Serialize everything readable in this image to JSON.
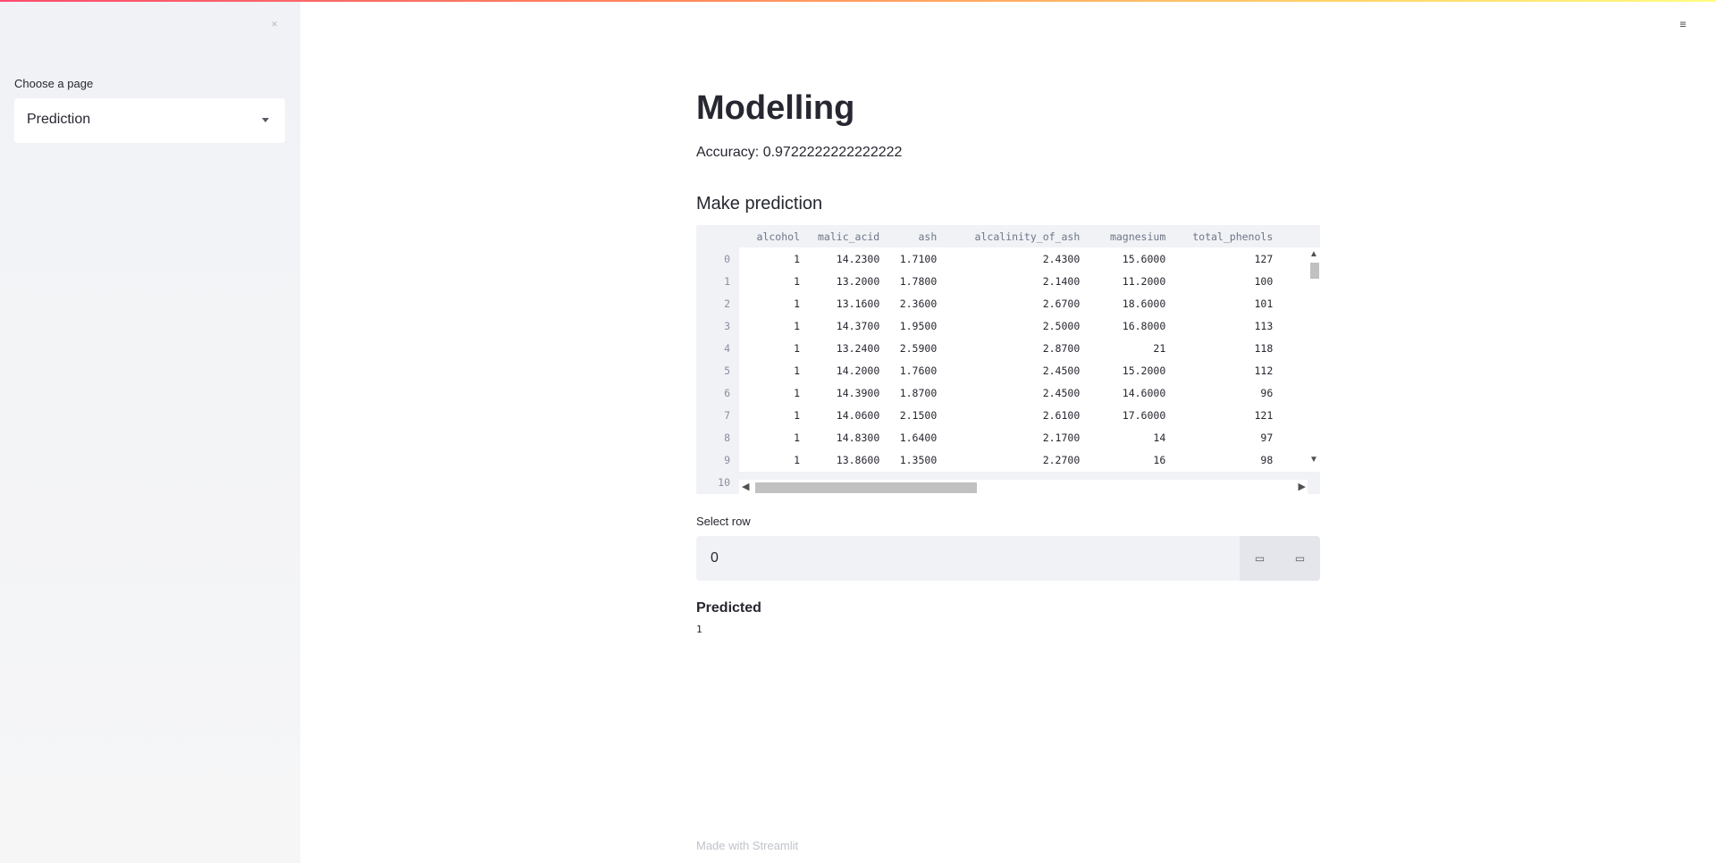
{
  "sidebar": {
    "collapse_icon": "collapse-icon",
    "select": {
      "label": "Choose a page",
      "value": "Prediction"
    }
  },
  "header": {
    "menu_icon": "hamburger-menu-icon"
  },
  "main": {
    "title": "Modelling",
    "accuracy": "Accuracy: 0.9722222222222222",
    "subheader": "Make prediction",
    "dataframe": {
      "columns": [
        "alcohol",
        "malic_acid",
        "ash",
        "alcalinity_of_ash",
        "magnesium",
        "total_phenols"
      ],
      "rows": [
        {
          "index": "0",
          "cells": [
            "1",
            "14.2300",
            "1.7100",
            "2.4300",
            "15.6000",
            "127"
          ]
        },
        {
          "index": "1",
          "cells": [
            "1",
            "13.2000",
            "1.7800",
            "2.1400",
            "11.2000",
            "100"
          ]
        },
        {
          "index": "2",
          "cells": [
            "1",
            "13.1600",
            "2.3600",
            "2.6700",
            "18.6000",
            "101"
          ]
        },
        {
          "index": "3",
          "cells": [
            "1",
            "14.3700",
            "1.9500",
            "2.5000",
            "16.8000",
            "113"
          ]
        },
        {
          "index": "4",
          "cells": [
            "1",
            "13.2400",
            "2.5900",
            "2.8700",
            "21",
            "118"
          ]
        },
        {
          "index": "5",
          "cells": [
            "1",
            "14.2000",
            "1.7600",
            "2.4500",
            "15.2000",
            "112"
          ]
        },
        {
          "index": "6",
          "cells": [
            "1",
            "14.3900",
            "1.8700",
            "2.4500",
            "14.6000",
            "96"
          ]
        },
        {
          "index": "7",
          "cells": [
            "1",
            "14.0600",
            "2.1500",
            "2.6100",
            "17.6000",
            "121"
          ]
        },
        {
          "index": "8",
          "cells": [
            "1",
            "14.8300",
            "1.6400",
            "2.1700",
            "14",
            "97"
          ]
        },
        {
          "index": "9",
          "cells": [
            "1",
            "13.8600",
            "1.3500",
            "2.2700",
            "16",
            "98"
          ]
        },
        {
          "index": "10",
          "cells": [
            "",
            "",
            "",
            "",
            "",
            ""
          ]
        }
      ]
    },
    "number_input": {
      "label": "Select row",
      "value": "0",
      "decrement_icon": "minus-icon",
      "increment_icon": "plus-icon"
    },
    "predicted": {
      "label": "Predicted",
      "value": "1"
    },
    "footer": "Made with Streamlit"
  }
}
